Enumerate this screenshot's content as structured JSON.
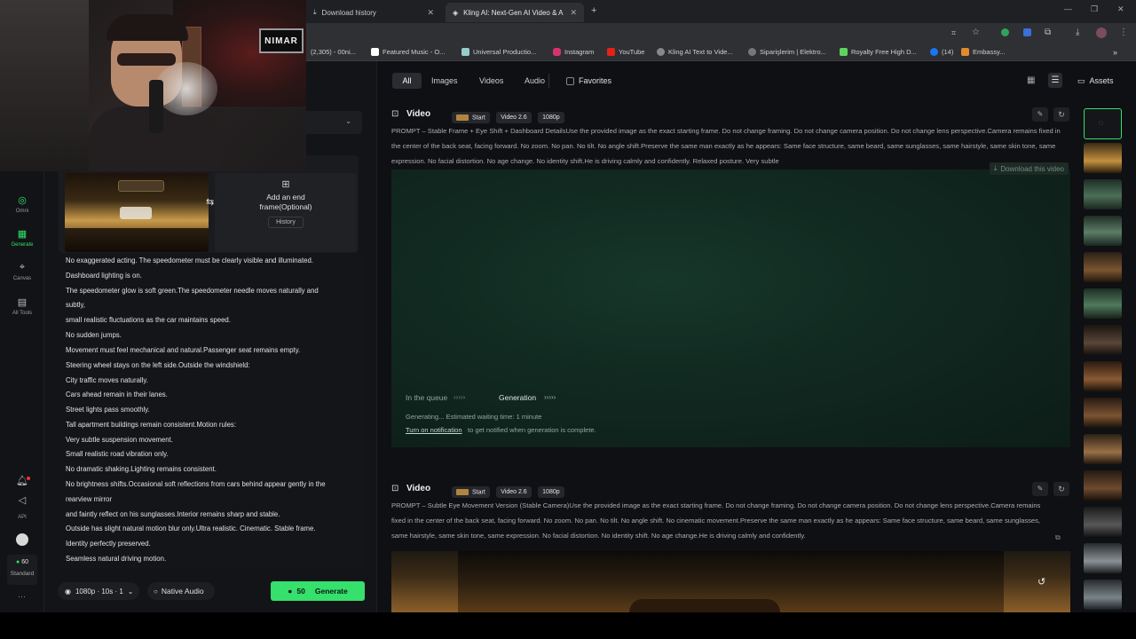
{
  "browser": {
    "tabs": [
      {
        "label": "Download history"
      },
      {
        "label": "Kling AI: Next-Gen AI Video & A"
      }
    ],
    "bookmarks": [
      {
        "label": "(2,305) - 00ni..."
      },
      {
        "label": "Featured Music - O..."
      },
      {
        "label": "Universal Productio..."
      },
      {
        "label": "Instagram"
      },
      {
        "label": "YouTube"
      },
      {
        "label": "Kling AI Text to Vide..."
      },
      {
        "label": "Siparişlerim | Elektro..."
      },
      {
        "label": "Royalty Free High D..."
      },
      {
        "label": "(14)"
      },
      {
        "label": "Embassy..."
      }
    ]
  },
  "webcam": {
    "sign_text": "NIMAR"
  },
  "rail": {
    "items": [
      {
        "label": "Omni"
      },
      {
        "label": "Generate"
      },
      {
        "label": "Canvas"
      },
      {
        "label": "All Tools"
      }
    ],
    "api": "API",
    "credits": "60",
    "plan": "Standard"
  },
  "panel": {
    "end_frame": {
      "label": "Add an end frame(Optional)",
      "history": "History"
    },
    "prompt_lines": [
      "No exaggerated acting. The speedometer must be clearly visible and illuminated.",
      "Dashboard lighting is on.",
      "The speedometer glow is soft green.The speedometer needle moves naturally and",
      "subtly,",
      "small realistic fluctuations as the car maintains speed.",
      "No sudden jumps.",
      "Movement must feel mechanical and natural.Passenger seat remains empty.",
      "Steering wheel stays on the left side.Outside the windshield:",
      "City traffic moves naturally.",
      "Cars ahead remain in their lanes.",
      "Street lights pass smoothly.",
      "Tall apartment buildings remain consistent.Motion rules:",
      "Very subtle suspension movement.",
      "Small realistic road vibration only.",
      "No dramatic shaking.Lighting remains consistent.",
      "No brightness shifts.Occasional soft reflections from cars behind appear gently in the",
      "rearview mirror",
      "and faintly reflect on his sunglasses.Interior remains sharp and stable.",
      "Outside has slight natural motion blur only.Ultra realistic. Cinematic. Stable frame.",
      "Identity perfectly preserved.",
      "Seamless natural driving motion."
    ],
    "settings": "1080p · 10s · 1",
    "native_audio": "Native Audio",
    "generate_cost": "50",
    "generate_label": "Generate"
  },
  "filters": {
    "tabs": [
      "All",
      "Images",
      "Videos",
      "Audio"
    ],
    "favorites": "Favorites",
    "assets": "Assets"
  },
  "cards": [
    {
      "type": "Video",
      "start": "Start",
      "model": "Video 2.6",
      "res": "1080p",
      "prompt": "PROMPT – Stable Frame + Eye Shift + Dashboard DetailsUse the provided image as the exact starting frame. Do not change framing. Do not change camera position. Do not change lens perspective.Camera remains fixed in the center of the back seat, facing forward. No zoom. No pan. No tilt. No angle shift.Preserve the same man exactly as he appears: Same face structure, same beard, same sunglasses, same hairstyle, same skin tone, same expression. No facial distortion. No age change. No identity shift.He is driving calmly and confidently. Relaxed posture. Very subtle",
      "download": "Download this video",
      "queue": "In the queue",
      "generation": "Generation",
      "status": "Generating... Estimated waiting time: 1 minute",
      "notify_link": "Turn on notification",
      "notify_rest": "to get notified when generation is complete."
    },
    {
      "type": "Video",
      "start": "Start",
      "model": "Video 2.6",
      "res": "1080p",
      "prompt": "PROMPT – Subtle Eye Movement Version (Stable Camera)Use the provided image as the exact starting frame. Do not change framing. Do not change camera position. Do not change lens perspective.Camera remains fixed in the center of the back seat, facing forward. No zoom. No pan. No tilt. No angle shift. No cinematic movement.Preserve the same man exactly as he appears: Same face structure, same beard, same sunglasses, same hairstyle, same skin tone, same expression. No facial distortion. No identity shift. No age change.He is driving calmly and confidently."
    }
  ],
  "colors": {
    "accent": "#2fe36b",
    "generate_bg": "#35e06c"
  }
}
